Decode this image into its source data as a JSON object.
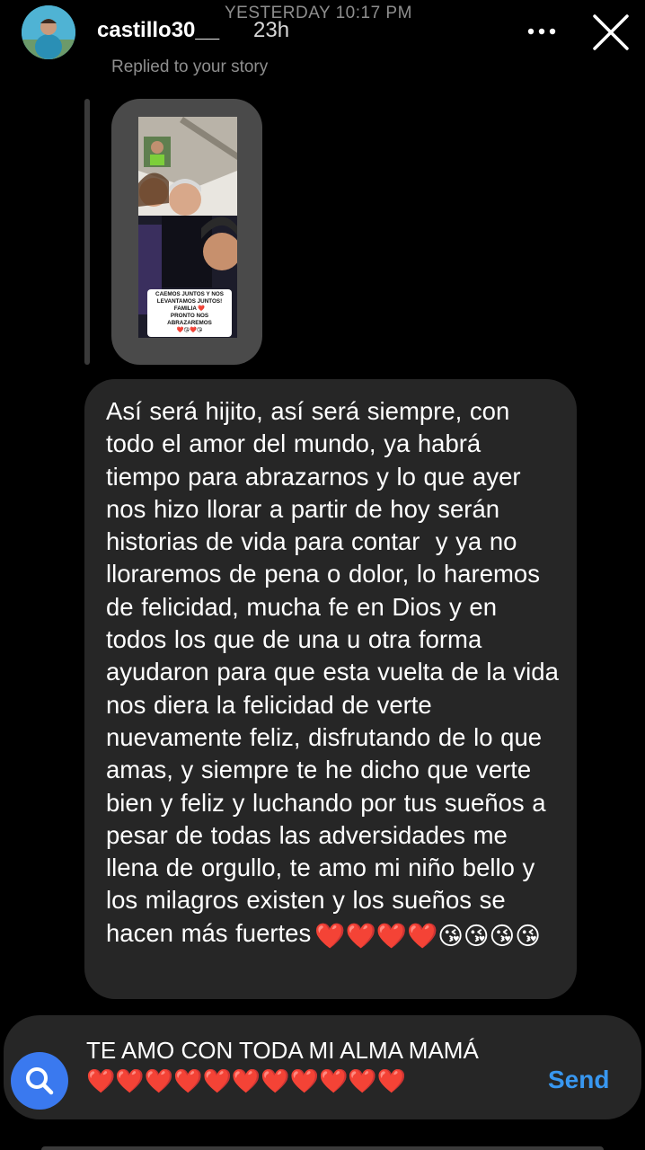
{
  "header": {
    "timestamp": "YESTERDAY 10:17 PM",
    "username": "castillo30__",
    "time_ago": "23h",
    "replied_label": "Replied to your story",
    "more_icon": "more-horizontal-icon",
    "close_icon": "close-icon"
  },
  "story": {
    "caption_line1": "CAEMOS JUNTOS Y NOS",
    "caption_line2": "LEVANTAMOS JUNTOS!",
    "caption_line3": "FAMILIA ❤️",
    "caption_line4": "PRONTO NOS",
    "caption_line5": "ABRAZAREMOS",
    "caption_line6": "❤️😘❤️😘"
  },
  "message": {
    "text": "Así será hijito, así será siempre, con todo el amor del mundo, ya habrá tiempo para abrazarnos y lo que ayer nos hizo llorar a partir de hoy serán historias de vida para contar  y ya no lloraremos de pena o dolor, lo haremos de felicidad, mucha fe en Dios y en todos los que de una u otra forma ayudaron para que esta vuelta de la vida nos diera la felicidad de verte     nuevamente feliz, disfrutando de lo que amas, y siempre te he dicho que verte bien y feliz y luchando por tus sueños a pesar de todas las adversidades me llena de orgullo, te amo mi niño bello y los milagros existen y los sueños se hacen más fuertes",
    "emojis": "❤️❤️❤️❤️😘😘😘😘"
  },
  "composer": {
    "text": "TE AMO CON TODA MI ALMA MAMÁ",
    "emojis": "❤️❤️❤️❤️❤️❤️❤️❤️❤️❤️❤️",
    "send_label": "Send",
    "search_icon": "search-icon"
  },
  "colors": {
    "background": "#000000",
    "bubble": "#262626",
    "send": "#3897f0",
    "search_button": "#3a79ef"
  }
}
